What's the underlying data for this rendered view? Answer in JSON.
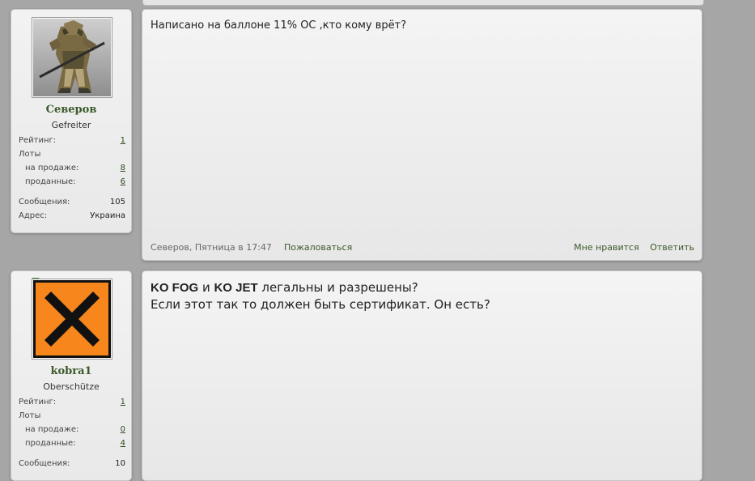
{
  "posts": [
    {
      "username": "Северов",
      "rank": "Gefreiter",
      "avatar_icon": "sniper-photo-avatar",
      "stats": {
        "rating_label": "Рейтинг:",
        "rating_value": "1",
        "lots_label": "Лоты",
        "for_sale_label": "на продаже:",
        "for_sale_value": "8",
        "sold_label": "проданные:",
        "sold_value": "6",
        "messages_label": "Сообщения:",
        "messages_value": "105",
        "address_label": "Адрес:",
        "address_value": "Украина"
      },
      "message": "Написано на баллоне 11% OC ,кто кому врёт?",
      "footer": {
        "meta": "Северов, Пятница в 17:47",
        "report": "Пожаловаться",
        "like": "Мне нравится",
        "reply": "Ответить"
      }
    },
    {
      "username": "kobra1",
      "rank": "Oberschütze",
      "avatar_icon": "hazard-x-avatar",
      "avatar_colors": {
        "background": "#f7861c",
        "cross": "#111111"
      },
      "stats": {
        "rating_label": "Рейтинг:",
        "rating_value": "1",
        "lots_label": "Лоты",
        "for_sale_label": "на продаже:",
        "for_sale_value": "0",
        "sold_label": "проданные:",
        "sold_value": "4",
        "messages_label": "Сообщения:",
        "messages_value": "10"
      },
      "message": {
        "bold1": "KO FOG",
        "conj": " и ",
        "bold2": "KO JET",
        "line1_rest": " легальны и разрешены?",
        "line2": "Если этот так то должен быть сертификат. Он есть?"
      }
    }
  ],
  "colors": {
    "accent_green": "#3b5a2b",
    "page_bg": "#a6a6a6"
  }
}
